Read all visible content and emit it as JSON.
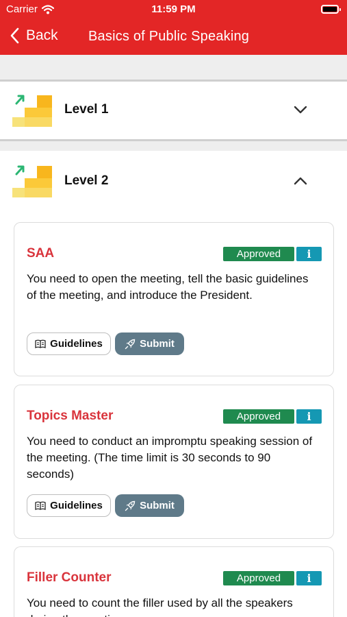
{
  "status_bar": {
    "carrier": "Carrier",
    "time": "11:59 PM"
  },
  "nav": {
    "back_label": "Back",
    "title": "Basics of Public Speaking"
  },
  "levels": [
    {
      "name": "Level 1",
      "expanded": false
    },
    {
      "name": "Level 2",
      "expanded": true
    }
  ],
  "tasks": [
    {
      "title": "SAA",
      "status": "Approved",
      "description": "You need to open the meeting, tell the basic guidelines of the meeting, and introduce the President.",
      "guidelines_label": "Guidelines",
      "submit_label": "Submit"
    },
    {
      "title": "Topics Master",
      "status": "Approved",
      "description": "You need to conduct an impromptu speaking session of the meeting. (The time limit is 30 seconds to 90 seconds)",
      "guidelines_label": "Guidelines",
      "submit_label": "Submit"
    },
    {
      "title": "Filler Counter",
      "status": "Approved",
      "description": "You need to count the filler used by all the speakers during the meeting."
    }
  ],
  "colors": {
    "header_red": "#e32626",
    "task_title_red": "#d9343c",
    "approved_green": "#1f8a4f",
    "info_teal": "#1598b3",
    "submit_slate": "#5f7a89"
  }
}
